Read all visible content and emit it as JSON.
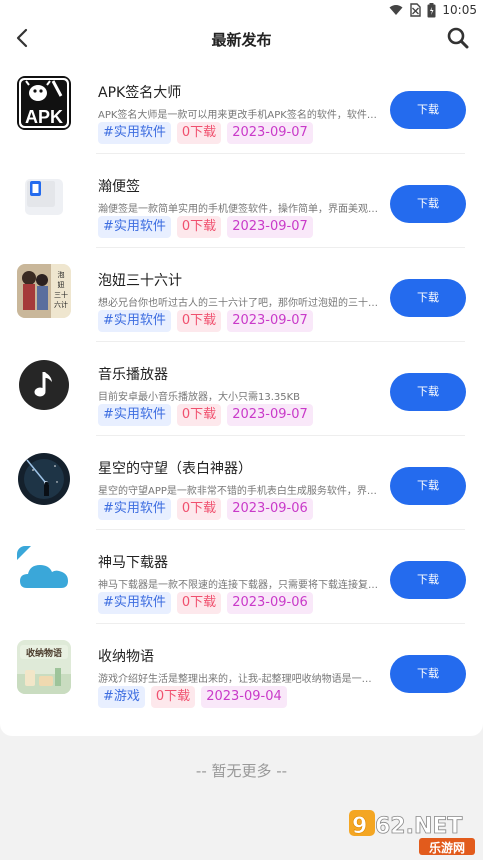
{
  "status_bar": {
    "time": "10:05"
  },
  "nav": {
    "title": "最新发布"
  },
  "apps": [
    {
      "name": "APK签名大师",
      "desc": "APK签名大师是一款可以用来更改手机APK签名的软件，软件功能强大",
      "category": "#实用软件",
      "downloads": "0下载",
      "date": "2023-09-07",
      "button": "下载",
      "icon": "apk-sign-icon"
    },
    {
      "name": "瀚便签",
      "desc": "瀚便签是一款简单实用的手机便签软件，操作简单，界面美观大方",
      "category": "#实用软件",
      "downloads": "0下载",
      "date": "2023-09-07",
      "button": "下载",
      "icon": "memo-icon"
    },
    {
      "name": "泡妞三十六计",
      "desc": "想必兄台你也听过古人的三十六计了吧，那你听过泡妞的三十六计吗",
      "category": "#实用软件",
      "downloads": "0下载",
      "date": "2023-09-07",
      "button": "下载",
      "icon": "book-cover-icon"
    },
    {
      "name": "音乐播放器",
      "desc": "目前安卓最小音乐播放器，大小只需13.35KB",
      "category": "#实用软件",
      "downloads": "0下载",
      "date": "2023-09-07",
      "button": "下载",
      "icon": "music-note-icon"
    },
    {
      "name": "星空的守望（表白神器）",
      "desc": "星空的守望APP是一款非常不错的手机表白生成服务软件，界面清新",
      "category": "#实用软件",
      "downloads": "0下载",
      "date": "2023-09-06",
      "button": "下载",
      "icon": "starry-sky-icon"
    },
    {
      "name": "神马下载器",
      "desc": "神马下载器是一款不限速的连接下载器，只需要将下载连接复制进来",
      "category": "#实用软件",
      "downloads": "0下载",
      "date": "2023-09-06",
      "button": "下载",
      "icon": "cloud-icon"
    },
    {
      "name": "收纳物语",
      "desc": "游戏介绍好生活是整理出来的，让我-起整理吧收纳物语是一款休闲游戏",
      "category": "#游戏",
      "downloads": "0下载",
      "date": "2023-09-04",
      "button": "下载",
      "icon": "storage-story-icon"
    }
  ],
  "footer": {
    "note": "-- 暂无更多 --"
  },
  "watermark": {
    "brand": "962.NET",
    "sub": "乐游网"
  },
  "colors": {
    "accent": "#246bee",
    "category_text": "#3d6de0",
    "download_text": "#f0506e",
    "date_text": "#c93ac9"
  }
}
